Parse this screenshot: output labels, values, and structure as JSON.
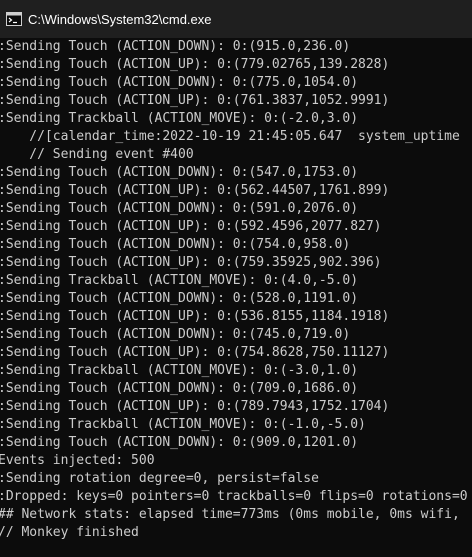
{
  "window": {
    "title": "C:\\Windows\\System32\\cmd.exe",
    "icon": "console-app-icon"
  },
  "console": {
    "lines": [
      ":Sending Touch (ACTION_DOWN): 0:(915.0,236.0)",
      ":Sending Touch (ACTION_UP): 0:(779.02765,139.2828)",
      ":Sending Touch (ACTION_DOWN): 0:(775.0,1054.0)",
      ":Sending Touch (ACTION_UP): 0:(761.3837,1052.9991)",
      ":Sending Trackball (ACTION_MOVE): 0:(-2.0,3.0)",
      "    //[calendar_time:2022-10-19 21:45:05.647  system_uptime",
      "    // Sending event #400",
      ":Sending Touch (ACTION_DOWN): 0:(547.0,1753.0)",
      ":Sending Touch (ACTION_UP): 0:(562.44507,1761.899)",
      ":Sending Touch (ACTION_DOWN): 0:(591.0,2076.0)",
      ":Sending Touch (ACTION_UP): 0:(592.4596,2077.827)",
      ":Sending Touch (ACTION_DOWN): 0:(754.0,958.0)",
      ":Sending Touch (ACTION_UP): 0:(759.35925,902.396)",
      ":Sending Trackball (ACTION_MOVE): 0:(4.0,-5.0)",
      ":Sending Touch (ACTION_DOWN): 0:(528.0,1191.0)",
      ":Sending Touch (ACTION_UP): 0:(536.8155,1184.1918)",
      ":Sending Touch (ACTION_DOWN): 0:(745.0,719.0)",
      ":Sending Touch (ACTION_UP): 0:(754.8628,750.11127)",
      ":Sending Trackball (ACTION_MOVE): 0:(-3.0,1.0)",
      ":Sending Touch (ACTION_DOWN): 0:(709.0,1686.0)",
      ":Sending Touch (ACTION_UP): 0:(789.7943,1752.1704)",
      ":Sending Trackball (ACTION_MOVE): 0:(-1.0,-5.0)",
      ":Sending Touch (ACTION_DOWN): 0:(909.0,1201.0)",
      "Events injected: 500",
      ":Sending rotation degree=0, persist=false",
      ":Dropped: keys=0 pointers=0 trackballs=0 flips=0 rotations=0",
      "## Network stats: elapsed time=773ms (0ms mobile, 0ms wifi,",
      "// Monkey finished"
    ]
  },
  "colors": {
    "background": "#0c0c0c",
    "titlebar": "#1f1f1f",
    "text": "#cccccc"
  }
}
